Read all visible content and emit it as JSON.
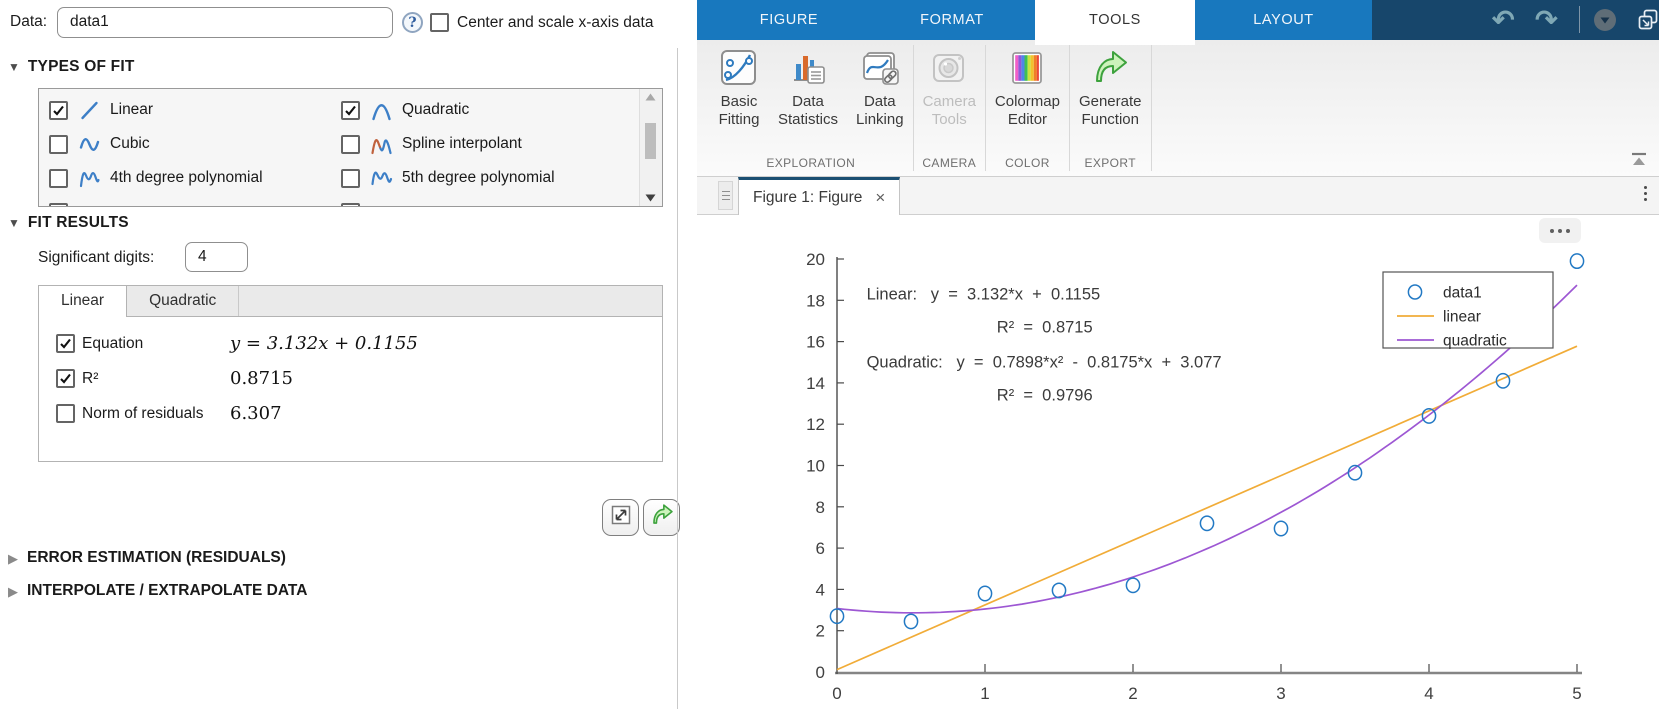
{
  "left_panel": {
    "data_row": {
      "label": "Data:",
      "dataset_value": "data1",
      "center_scale_label": "Center and scale x-axis data",
      "center_scale_checked": false
    },
    "types_of_fit": {
      "title": "TYPES OF FIT",
      "items": [
        {
          "label": "Linear",
          "checked": true,
          "icon": "linear-fit-icon"
        },
        {
          "label": "Quadratic",
          "checked": true,
          "icon": "quadratic-fit-icon"
        },
        {
          "label": "Cubic",
          "checked": false,
          "icon": "cubic-fit-icon"
        },
        {
          "label": "Spline interpolant",
          "checked": false,
          "icon": "spline-fit-icon"
        },
        {
          "label": "4th degree polynomial",
          "checked": false,
          "icon": "poly4-fit-icon"
        },
        {
          "label": "5th degree polynomial",
          "checked": false,
          "icon": "poly5-fit-icon"
        },
        {
          "label": "",
          "checked": false,
          "icon": "poly6-fit-icon"
        },
        {
          "label": "",
          "checked": false,
          "icon": "poly7-fit-icon"
        }
      ]
    },
    "fit_results": {
      "title": "FIT RESULTS",
      "significant_digits_label": "Significant digits:",
      "significant_digits_value": "4",
      "tabs": [
        {
          "label": "Linear",
          "active": true
        },
        {
          "label": "Quadratic",
          "active": false
        }
      ],
      "rows": [
        {
          "label": "Equation",
          "checked": true,
          "value": "y = 3.132x + 0.1155",
          "italic": true
        },
        {
          "label": "R²",
          "checked": true,
          "value": "0.8715",
          "italic": false
        },
        {
          "label": "Norm of residuals",
          "checked": false,
          "value": "6.307",
          "italic": false
        }
      ]
    },
    "collapsed_sections": [
      "ERROR ESTIMATION (RESIDUALS)",
      "INTERPOLATE / EXTRAPOLATE DATA"
    ]
  },
  "ribbon": {
    "tabs": [
      {
        "label": "FIGURE",
        "active": false
      },
      {
        "label": "FORMAT",
        "active": false
      },
      {
        "label": "TOOLS",
        "active": true
      },
      {
        "label": "LAYOUT",
        "active": false
      }
    ],
    "groups": [
      {
        "label": "EXPLORATION",
        "buttons": [
          {
            "label_lines": [
              "Basic",
              "Fitting"
            ],
            "icon": "basic-fitting-icon",
            "disabled": false
          },
          {
            "label_lines": [
              "Data",
              "Statistics"
            ],
            "icon": "data-statistics-icon",
            "disabled": false
          },
          {
            "label_lines": [
              "Data",
              "Linking"
            ],
            "icon": "data-linking-icon",
            "disabled": false
          }
        ]
      },
      {
        "label": "CAMERA",
        "buttons": [
          {
            "label_lines": [
              "Camera",
              "Tools"
            ],
            "icon": "camera-tools-icon",
            "disabled": true
          }
        ]
      },
      {
        "label": "COLOR",
        "buttons": [
          {
            "label_lines": [
              "Colormap",
              "Editor"
            ],
            "icon": "colormap-editor-icon",
            "disabled": false
          }
        ]
      },
      {
        "label": "EXPORT",
        "buttons": [
          {
            "label_lines": [
              "Generate",
              "Function"
            ],
            "icon": "generate-function-icon",
            "disabled": false
          }
        ]
      }
    ],
    "accent_color": "#1878be",
    "dark_color": "#17466b"
  },
  "figure_tab": {
    "label": "Figure 1: Figure",
    "close_glyph": "×"
  },
  "chart_data": {
    "type": "scatter",
    "title": "",
    "xlabel": "",
    "ylabel": "",
    "xlim": [
      0,
      5
    ],
    "ylim": [
      0,
      20
    ],
    "xticks": [
      0,
      1,
      2,
      3,
      4,
      5
    ],
    "yticks": [
      0,
      2,
      4,
      6,
      8,
      10,
      12,
      14,
      16,
      18,
      20
    ],
    "grid": false,
    "legend_position": "top-right",
    "x": [
      0,
      0.5,
      1,
      1.5,
      2,
      2.5,
      3,
      3.5,
      4,
      4.5,
      5
    ],
    "series": [
      {
        "name": "data1",
        "type": "scatter",
        "color": "#2279c4",
        "values": [
          2.7,
          2.45,
          3.8,
          3.95,
          4.2,
          7.2,
          6.95,
          9.65,
          12.4,
          14.1,
          19.9
        ]
      },
      {
        "name": "linear",
        "type": "line",
        "color": "#f1ac38",
        "coeffs": [
          3.132,
          0.1155
        ],
        "equation": "y = 3.132*x + 0.1155",
        "r_squared": 0.8715
      },
      {
        "name": "quadratic",
        "type": "line",
        "color": "#9d57d3",
        "coeffs": [
          0.7898,
          -0.8175,
          3.077
        ],
        "equation": "y = 0.7898*x² - 0.8175*x + 3.077",
        "r_squared": 0.9796
      }
    ],
    "annotations": [
      {
        "x": 0.2,
        "y": 18.05,
        "text": "Linear:   y  =  3.132*x  +  0.1155"
      },
      {
        "x": 1.08,
        "y": 16.45,
        "text": "R²  =  0.8715"
      },
      {
        "x": 0.2,
        "y": 14.75,
        "text": "Quadratic:   y  =  0.7898*x²  -  0.8175*x  +  3.077"
      },
      {
        "x": 1.08,
        "y": 13.15,
        "text": "R²  =  0.9796"
      }
    ]
  }
}
